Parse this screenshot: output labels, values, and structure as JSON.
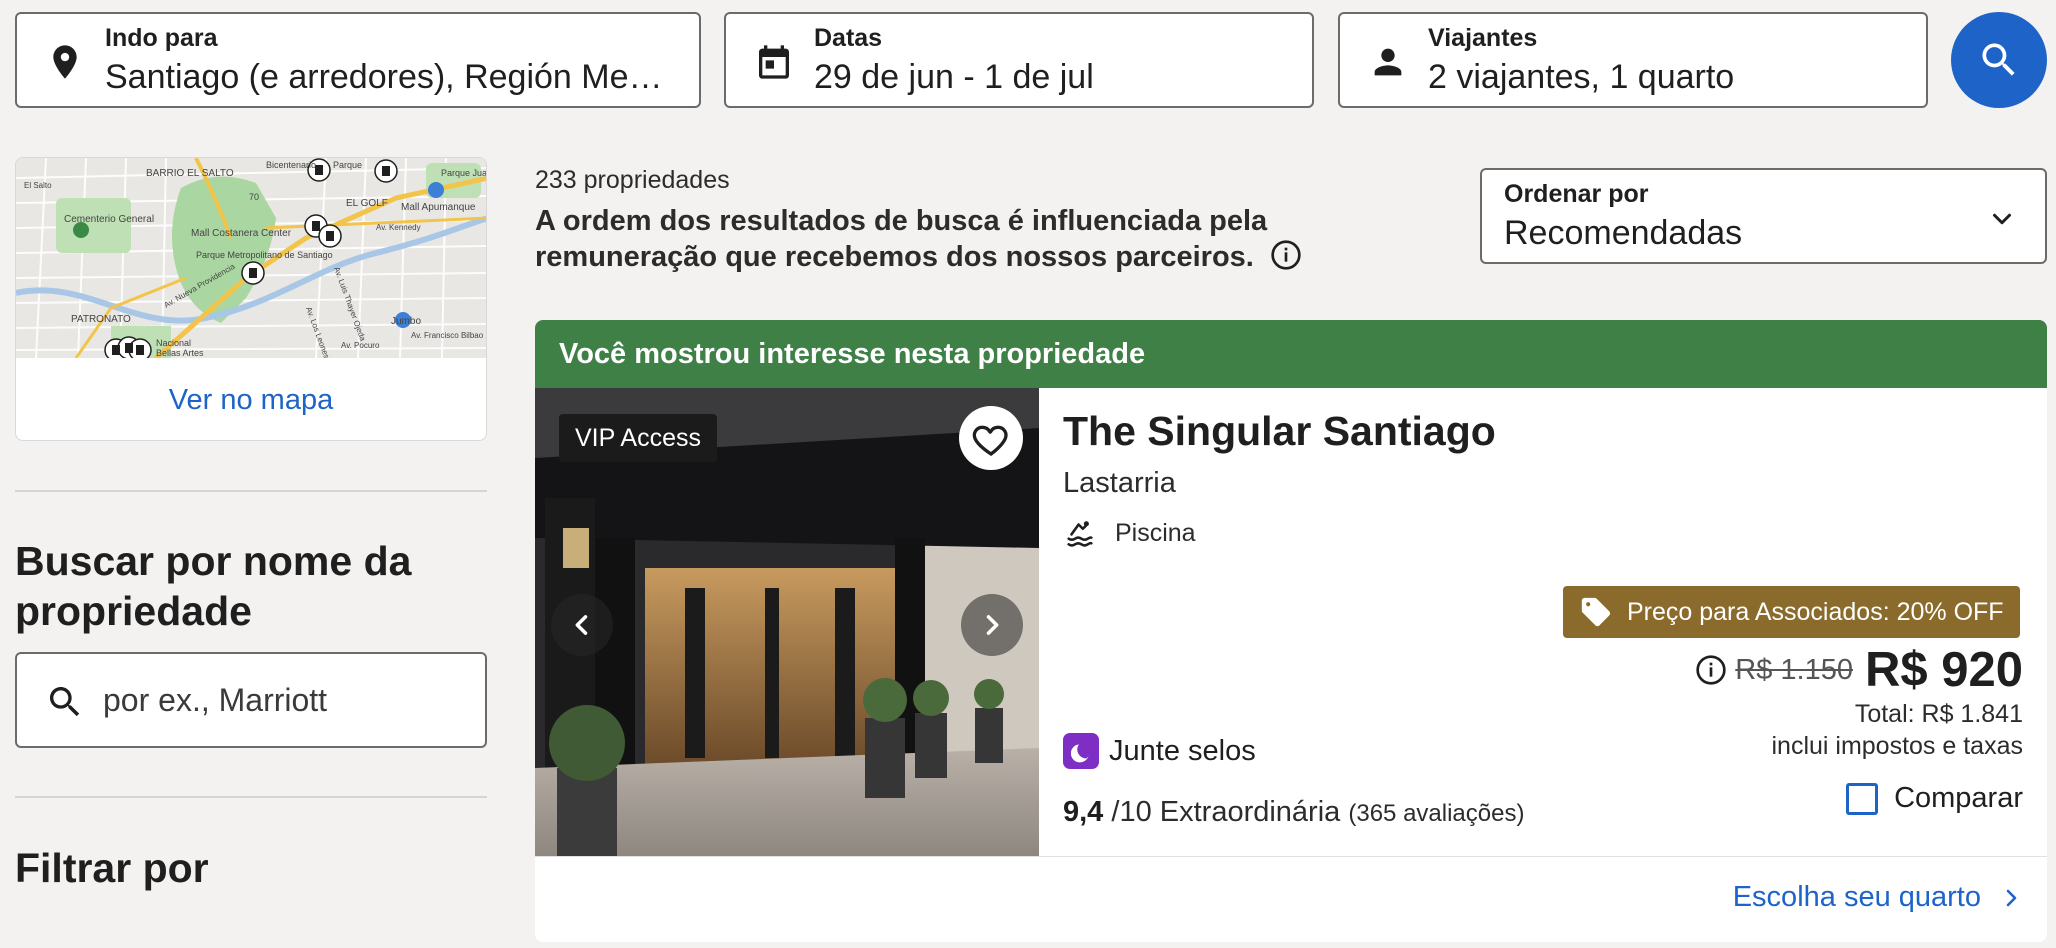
{
  "search": {
    "destination": {
      "label": "Indo para",
      "value": "Santiago (e arredores), Región Metropolitana, Chile",
      "icon": "location-pin-icon"
    },
    "dates": {
      "label": "Datas",
      "value": "29 de jun - 1 de jul",
      "icon": "calendar-icon"
    },
    "travelers": {
      "label": "Viajantes",
      "value": "2 viajantes, 1 quarto",
      "icon": "person-icon"
    },
    "button_icon": "search-icon"
  },
  "sidebar": {
    "map": {
      "link": "Ver no mapa",
      "labels": [
        "BARRIO EL SALTO",
        "Cementerio General",
        "Mall Costanera Center",
        "Parque Metropolitano de Santiago",
        "Mall Apumanque",
        "Parque Juan Pablo II",
        "PATRONATO",
        "Jumbo",
        "EL GOLF",
        "Bicentenario",
        "Parque",
        "Nacional",
        "Bellas Artes",
        "Av. Francisco Bilbao",
        "Av. Nueva Providencia",
        "Av. Los Leones",
        "Av. Pocuro",
        "Av. Luis Thayer Ojeda",
        "70",
        "El Salto",
        "Av. Kennedy"
      ]
    },
    "search_heading": "Buscar por nome da propriedade",
    "search_placeholder": "por ex., Marriott",
    "filter_heading": "Filtrar por"
  },
  "results": {
    "count": "233 propriedades",
    "disclaimer": "A ordem dos resultados de busca é influenciada pela remuneração que recebemos dos nossos parceiros.",
    "sort": {
      "label": "Ordenar por",
      "value": "Recomendadas"
    }
  },
  "property": {
    "banner": "Você mostrou interesse nesta propriedade",
    "badge": "VIP Access",
    "name": "The Singular Santiago",
    "neighborhood": "Lastarria",
    "amenity": "Piscina",
    "stamps": "Junte selos",
    "rating_score": "9,4",
    "rating_scale": "/10 Extraordinária",
    "reviews": "(365 avaliações)",
    "deal": "Preço para Associados: 20% OFF",
    "old_price": "R$ 1.150",
    "price": "R$ 920",
    "total": "Total: R$ 1.841",
    "taxes": "inclui impostos e taxas",
    "compare": "Comparar",
    "choose_room": "Escolha seu quarto"
  },
  "colors": {
    "accent": "#1e64c8",
    "banner_green": "#3f8047",
    "deal_gold": "#8a6b2c",
    "stamp_purple": "#7f2ec5",
    "background": "#f3f2f0"
  }
}
